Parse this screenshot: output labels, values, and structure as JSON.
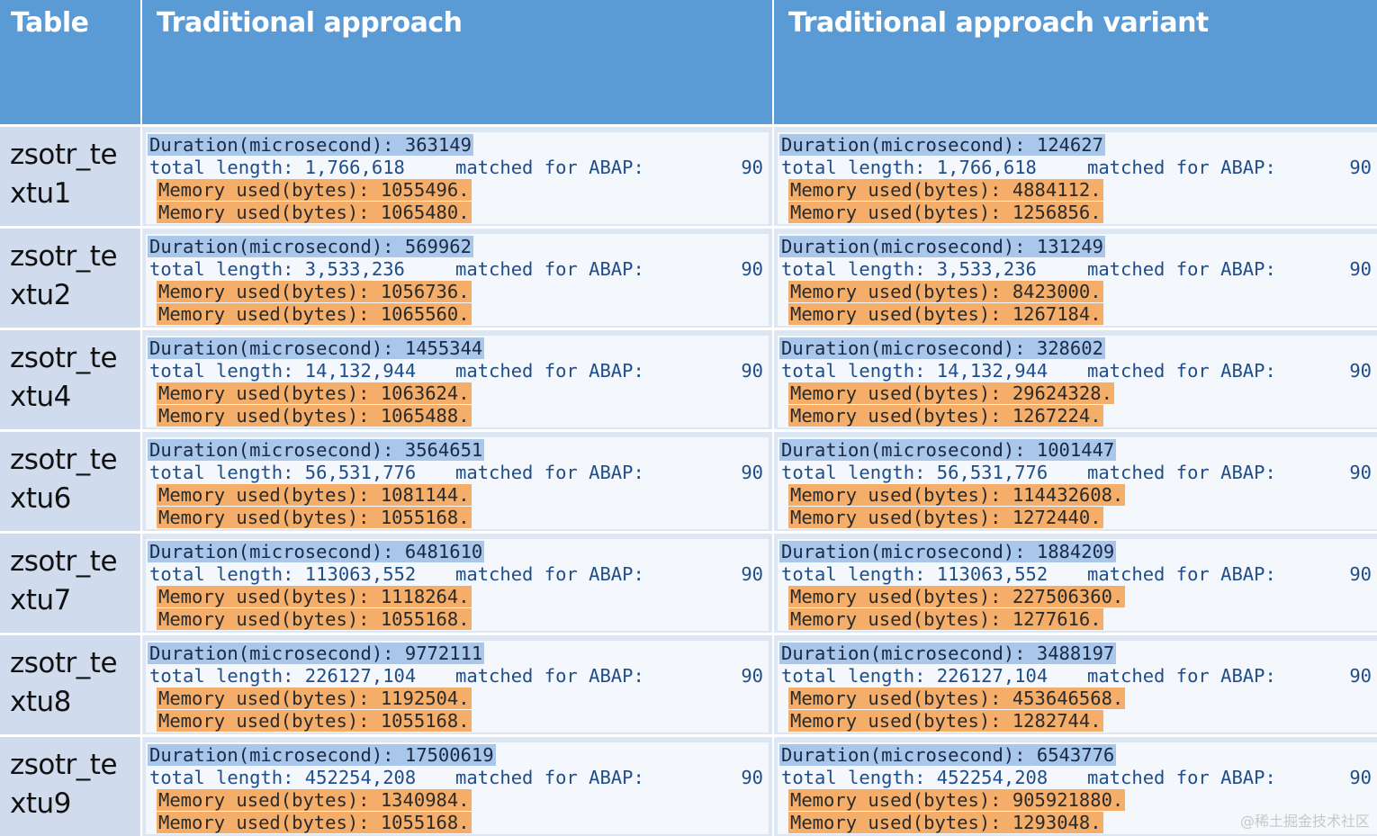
{
  "headers": {
    "table": "Table",
    "traditional": "Traditional approach",
    "variant": "Traditional approach variant"
  },
  "labels": {
    "duration": "Duration(microsecond):",
    "total_length": "total length:",
    "matched": "matched for ABAP:",
    "memory": "Memory used(bytes):"
  },
  "rows": [
    {
      "name_line1": "zsotr_te",
      "name_line2": "xtu1",
      "traditional": {
        "duration": "363149",
        "total_length": "1,766,618",
        "matched": "90",
        "mem1": "1055496.",
        "mem2": "1065480."
      },
      "variant": {
        "duration": "124627",
        "total_length": "1,766,618",
        "matched": "90",
        "mem1": "4884112.",
        "mem2": "1256856."
      }
    },
    {
      "name_line1": "zsotr_te",
      "name_line2": "xtu2",
      "traditional": {
        "duration": "569962",
        "total_length": "3,533,236",
        "matched": "90",
        "mem1": "1056736.",
        "mem2": "1065560."
      },
      "variant": {
        "duration": "131249",
        "total_length": "3,533,236",
        "matched": "90",
        "mem1": "8423000.",
        "mem2": "1267184."
      }
    },
    {
      "name_line1": "zsotr_te",
      "name_line2": "xtu4",
      "traditional": {
        "duration": "1455344",
        "total_length": "14,132,944",
        "matched": "90",
        "mem1": "1063624.",
        "mem2": "1065488."
      },
      "variant": {
        "duration": "328602",
        "total_length": "14,132,944",
        "matched": "90",
        "mem1": "29624328.",
        "mem2": "1267224."
      }
    },
    {
      "name_line1": "zsotr_te",
      "name_line2": "xtu6",
      "traditional": {
        "duration": "3564651",
        "total_length": "56,531,776",
        "matched": "90",
        "mem1": "1081144.",
        "mem2": "1055168."
      },
      "variant": {
        "duration": "1001447",
        "total_length": "56,531,776",
        "matched": "90",
        "mem1": "114432608.",
        "mem2": "1272440."
      }
    },
    {
      "name_line1": "zsotr_te",
      "name_line2": "xtu7",
      "traditional": {
        "duration": "6481610",
        "total_length": "113063,552",
        "matched": "90",
        "mem1": "1118264.",
        "mem2": "1055168."
      },
      "variant": {
        "duration": "1884209",
        "total_length": "113063,552",
        "matched": "90",
        "mem1": "227506360.",
        "mem2": "1277616."
      }
    },
    {
      "name_line1": "zsotr_te",
      "name_line2": "xtu8",
      "traditional": {
        "duration": "9772111",
        "total_length": "226127,104",
        "matched": "90",
        "mem1": "1192504.",
        "mem2": "1055168."
      },
      "variant": {
        "duration": "3488197",
        "total_length": "226127,104",
        "matched": "90",
        "mem1": "453646568.",
        "mem2": "1282744."
      }
    },
    {
      "name_line1": "zsotr_te",
      "name_line2": "xtu9",
      "traditional": {
        "duration": "17500619",
        "total_length": "452254,208",
        "matched": "90",
        "mem1": "1340984.",
        "mem2": "1055168."
      },
      "variant": {
        "duration": "6543776",
        "total_length": "452254,208",
        "matched": "90",
        "mem1": "905921880.",
        "mem2": "1293048."
      }
    }
  ],
  "watermark": "@稀土掘金技术社区"
}
